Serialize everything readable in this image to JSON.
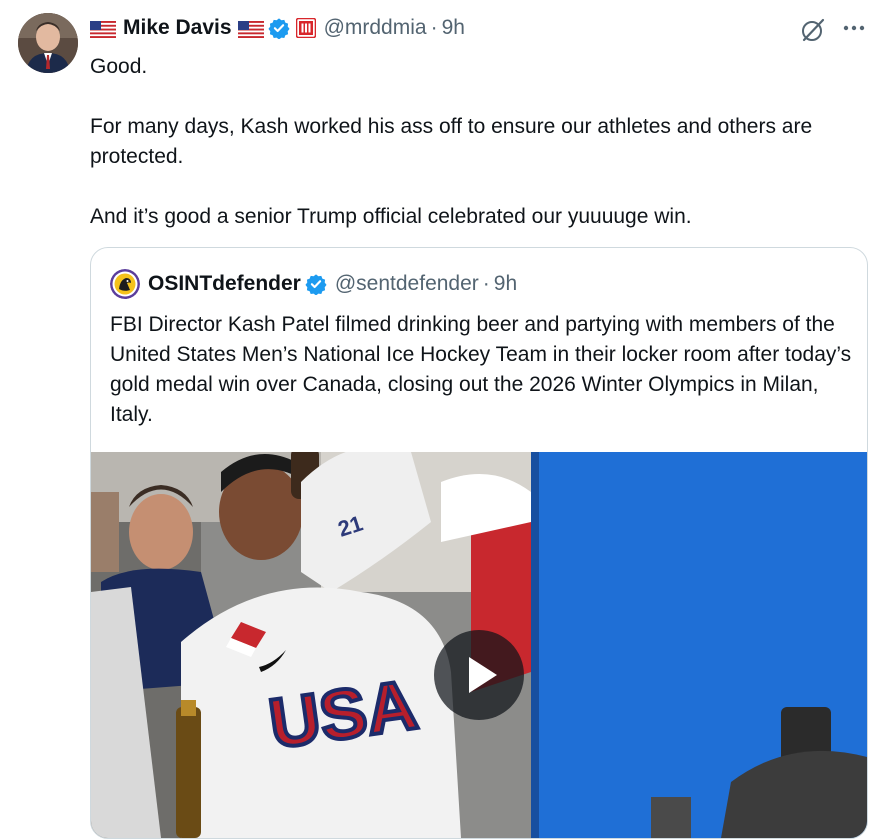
{
  "author": {
    "name": "Mike Davis",
    "handle": "@mrddmia",
    "separator": "·",
    "time": "9h",
    "icons": [
      "us-flag-icon",
      "verified-badge-icon",
      "red-square-badge-icon"
    ]
  },
  "post": {
    "paragraphs": [
      "Good.",
      "For many days, Kash worked his ass off to ensure our athletes and others are protected.",
      "And it’s good a senior Trump official celebrated our yuuuuge win."
    ]
  },
  "quote": {
    "name": "OSINTdefender",
    "handle": "@sentdefender",
    "separator": "·",
    "time": "9h",
    "text": "FBI Director Kash Patel filmed drinking beer and partying with members of the United States Men’s National Ice Hockey Team in their locker room after today’s gold medal win over Canada, closing out the 2026 Winter Olympics in Milan, Italy.",
    "media": {
      "jersey_text": "USA",
      "jersey_number": "21",
      "play_icon": "play-icon"
    }
  },
  "actions": {
    "grok_icon": "grok-icon",
    "more_icon": "more-icon"
  },
  "colors": {
    "text": "#0f1419",
    "secondary": "#536471",
    "verified": "#1d9bf0",
    "border": "#cfd9de",
    "media_blue": "#1f6fd6"
  }
}
